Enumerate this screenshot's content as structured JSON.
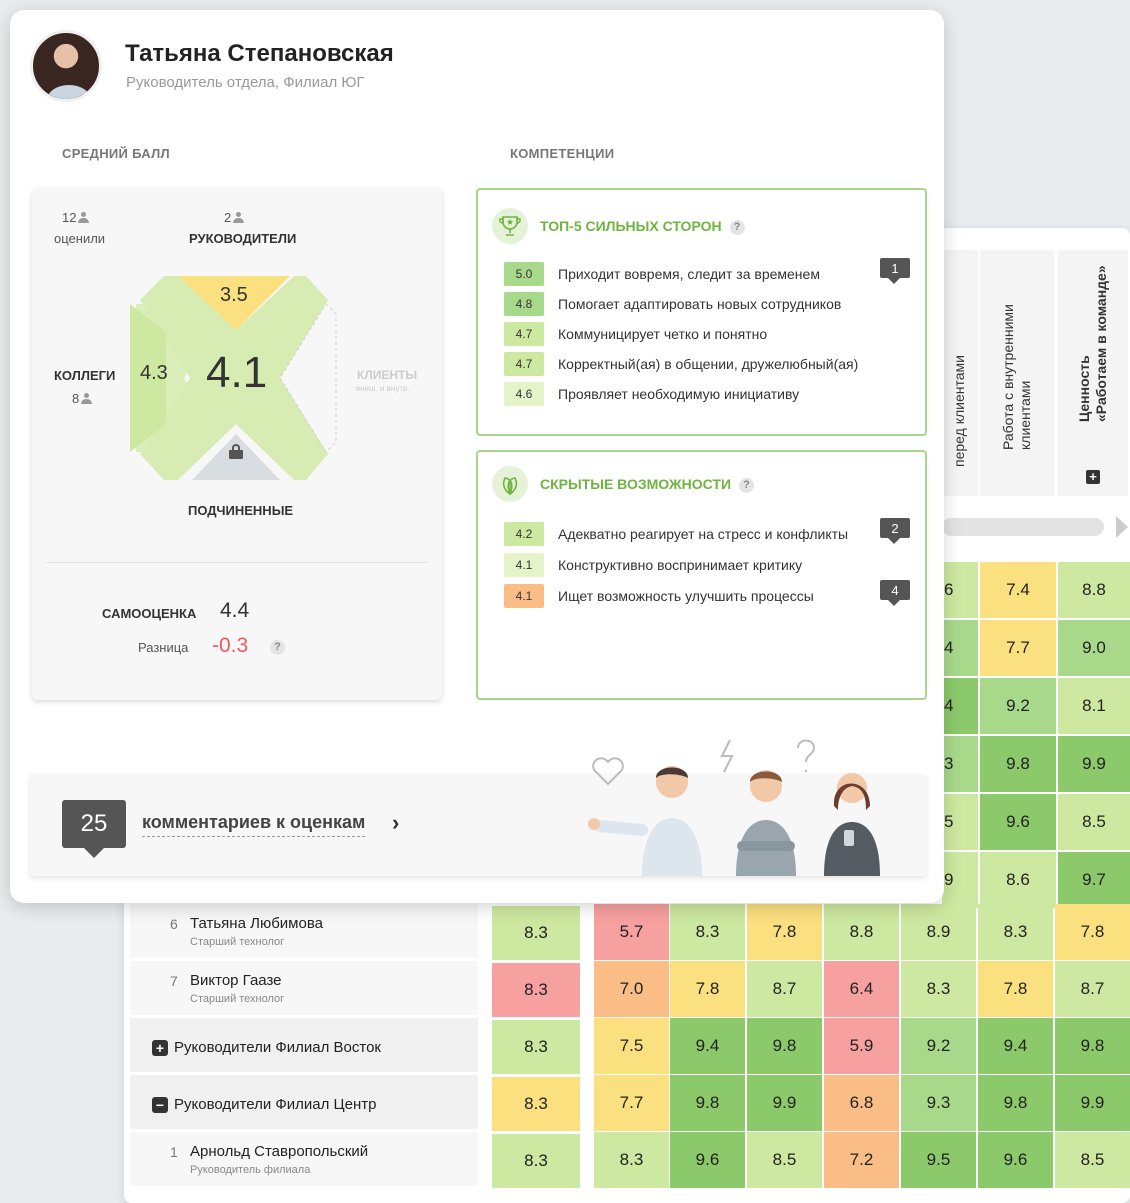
{
  "profile": {
    "name": "Татьяна Степановская",
    "role": "Руководитель отдела, Филиал ЮГ"
  },
  "sections": {
    "avg_score": "СРЕДНИЙ БАЛЛ",
    "competencies": "КОМПЕТЕНЦИИ"
  },
  "score": {
    "rated_count": "12",
    "rated_label": "оценили",
    "managers_count": "2",
    "managers_label": "РУКОВОДИТЕЛИ",
    "managers_score": "3.5",
    "colleagues_label": "КОЛЛЕГИ",
    "colleagues_count": "8",
    "colleagues_score": "4.3",
    "overall": "4.1",
    "clients_label": "КЛИЕНТЫ",
    "clients_sub": "внеш. и внутр.",
    "subordinates_label": "ПОДЧИНЕННЫЕ",
    "self_label": "САМООЦЕНКА",
    "self_value": "4.4",
    "diff_label": "Разница",
    "diff_value": "-0.3",
    "help": "?"
  },
  "strengths": {
    "title": "ТОП-5 СИЛЬНЫХ СТОРОН",
    "items": [
      {
        "score": "5.0",
        "text": "Приходит вовремя, следит за временем",
        "badge": "1"
      },
      {
        "score": "4.8",
        "text": "Помогает адаптировать новых сотрудников",
        "badge": ""
      },
      {
        "score": "4.7",
        "text": "Коммуницирует четко и понятно",
        "badge": ""
      },
      {
        "score": "4.7",
        "text": "Корректный(ая) в общении, дружелюбный(ая)",
        "badge": ""
      },
      {
        "score": "4.6",
        "text": "Проявляет необходимую инициативу",
        "badge": ""
      }
    ]
  },
  "hidden": {
    "title": "СКРЫТЫЕ ВОЗМОЖНОСТИ",
    "items": [
      {
        "score": "4.2",
        "text": "Адекватно реагирует на стресс и конфликты",
        "badge": "2"
      },
      {
        "score": "4.1",
        "text": "Конструктивно воспринимает критику",
        "badge": ""
      },
      {
        "score": "4.1",
        "text": "Ищет возможность улучшить процессы",
        "badge": "4"
      }
    ]
  },
  "comments": {
    "count": "25",
    "link": "комментариев к оценкам",
    "chevron": "›"
  },
  "table": {
    "headers": [
      {
        "text": "перед клиентами",
        "bold": false
      },
      {
        "text": "Работа с внутренними\nклиентами",
        "bold": false
      },
      {
        "text": "Ценность\n«Работаем в команде»",
        "bold": true
      }
    ],
    "header_plus": "+",
    "partial_rows": [
      {
        "cells": [
          "6",
          "7.4",
          "8.8"
        ]
      },
      {
        "cells": [
          "4",
          "7.7",
          "9.0"
        ]
      },
      {
        "cells": [
          "4",
          "9.2",
          "8.1"
        ]
      },
      {
        "cells": [
          "3",
          "9.8",
          "9.9"
        ]
      },
      {
        "cells": [
          "5",
          "9.6",
          "8.5"
        ]
      },
      {
        "cells": [
          "9",
          "8.6",
          "9.7"
        ]
      }
    ],
    "rows": [
      {
        "type": "person",
        "num": "6",
        "name": "Татьяна Любимова",
        "sub": "Старший технолог",
        "main": "8.3",
        "cells": [
          "5.7",
          "8.3",
          "7.8",
          "8.8",
          "8.9",
          "8.3",
          "7.8"
        ]
      },
      {
        "type": "person",
        "num": "7",
        "name": "Виктор Гаазе",
        "sub": "Старший технолог",
        "main": "8.3",
        "cells": [
          "7.0",
          "7.8",
          "8.7",
          "6.4",
          "8.3",
          "7.8",
          "8.7"
        ]
      },
      {
        "type": "group",
        "icon": "+",
        "name": "Руководители Филиал Восток",
        "main": "8.3",
        "cells": [
          "7.5",
          "9.4",
          "9.8",
          "5.9",
          "9.2",
          "9.4",
          "9.8"
        ]
      },
      {
        "type": "group",
        "icon": "−",
        "name": "Руководители Филиал Центр",
        "main": "8.3",
        "cells": [
          "7.7",
          "9.8",
          "9.9",
          "6.8",
          "9.3",
          "9.8",
          "9.9"
        ]
      },
      {
        "type": "person",
        "num": "1",
        "name": "Арнольд Ставропольский",
        "sub": "Руководитель филиала",
        "main": "8.3",
        "cells": [
          "8.3",
          "9.6",
          "8.5",
          "7.2",
          "9.5",
          "9.6",
          "8.5"
        ]
      }
    ]
  },
  "colors": {
    "dark_green": "#8cc96a",
    "green": "#a8d98a",
    "light_green": "#cde8a0",
    "yellow": "#fbe07f",
    "orange": "#fbbd86",
    "red": "#f7a0a0",
    "accent": "#6fb43f"
  }
}
